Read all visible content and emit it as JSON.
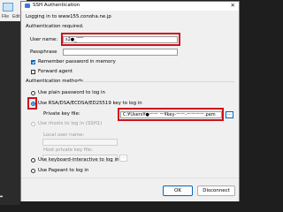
{
  "background": {
    "menu_file": "File",
    "menu_edit": "Edit"
  },
  "dialog": {
    "title": "SSH Authentication",
    "close_glyph": "✕",
    "login_info": "Logging in to www155.conoha.ne.jp",
    "auth_required": "Authentication required.",
    "user_name_label": "User name:",
    "user_name_value": "s2●_ ̄ ̄ ̄ ̄ ̄",
    "passphrase_label": "Passphrase",
    "passphrase_value": "",
    "remember_label": "Remember password in memory",
    "remember_checked": true,
    "forward_label": "Forward agent",
    "forward_checked": false,
    "methods_label": "Authentication methods",
    "methods": [
      {
        "label": "Use plain password to log in",
        "selected": false,
        "enabled": true
      },
      {
        "label": "Use RSA/DSA/ECDSA/ED25519 key to log in",
        "selected": true,
        "enabled": true
      },
      {
        "label": "Use rhosts to log in (SSH1)",
        "selected": false,
        "enabled": false
      },
      {
        "label": "Use keyboard-interactive to log in",
        "selected": false,
        "enabled": true
      },
      {
        "label": "Use Pageant to log in",
        "selected": false,
        "enabled": true
      }
    ],
    "private_key_label": "Private key file:",
    "private_key_value": "C:¥Users¥●ーー ー¥key-ーー-ーーーー.pem",
    "browse_label": "...",
    "local_user_label": "Local user name:",
    "host_key_label": "Host private key file:",
    "ok_label": "OK",
    "disconnect_label": "Disconnect"
  }
}
